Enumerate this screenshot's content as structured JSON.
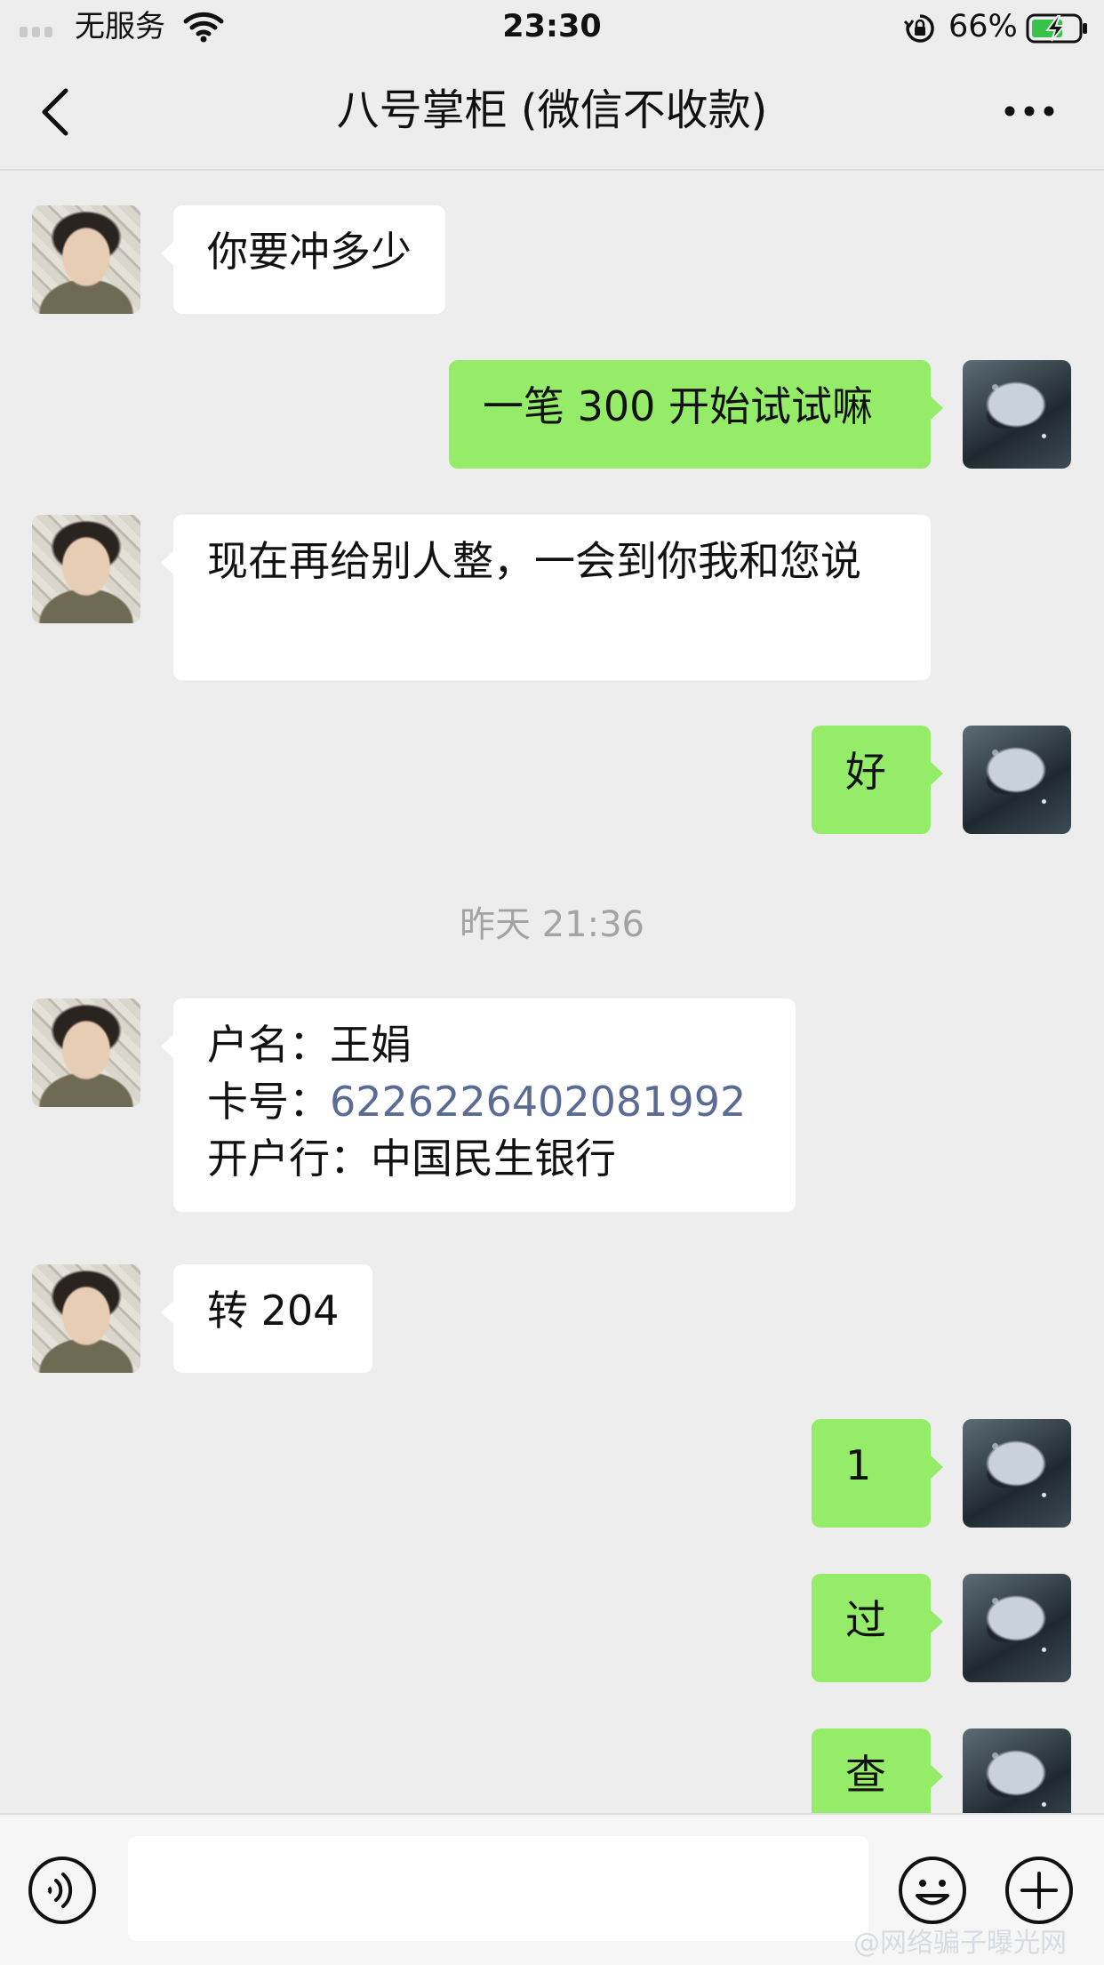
{
  "status_bar": {
    "carrier": "无服务",
    "time": "23:30",
    "battery_percent": "66%"
  },
  "nav": {
    "title": "八号掌柜 (微信不收款)"
  },
  "messages": [
    {
      "side": "in",
      "text": "你要冲多少"
    },
    {
      "side": "out",
      "text": "一笔 300 开始试试嘛"
    },
    {
      "side": "in",
      "text": "现在再给别人整，一会到你我和您说"
    },
    {
      "side": "out",
      "text": "好"
    },
    {
      "side": "in",
      "account_name_label": "户名：",
      "account_name": "王娟",
      "card_label": "卡号：",
      "card_number": "6226226402081992",
      "bank_label": "开户行：",
      "bank": "中国民生银行"
    },
    {
      "side": "in",
      "text": "转 204"
    },
    {
      "side": "out",
      "text": "1"
    },
    {
      "side": "out",
      "text": "过"
    },
    {
      "side": "out",
      "text": "查"
    }
  ],
  "timestamp": "昨天 21:36",
  "input": {
    "value": ""
  },
  "watermark": "@网络骗子曝光网",
  "colors": {
    "background": "#ededed",
    "incoming_bubble": "#ffffff",
    "outgoing_bubble": "#95ec69",
    "link": "#5a6b95",
    "timestamp": "#a3a3a3"
  },
  "icons": [
    "back-icon",
    "more-icon",
    "wifi-icon",
    "orientation-lock-icon",
    "battery-charging-icon",
    "voice-icon",
    "emoji-icon",
    "plus-icon"
  ]
}
